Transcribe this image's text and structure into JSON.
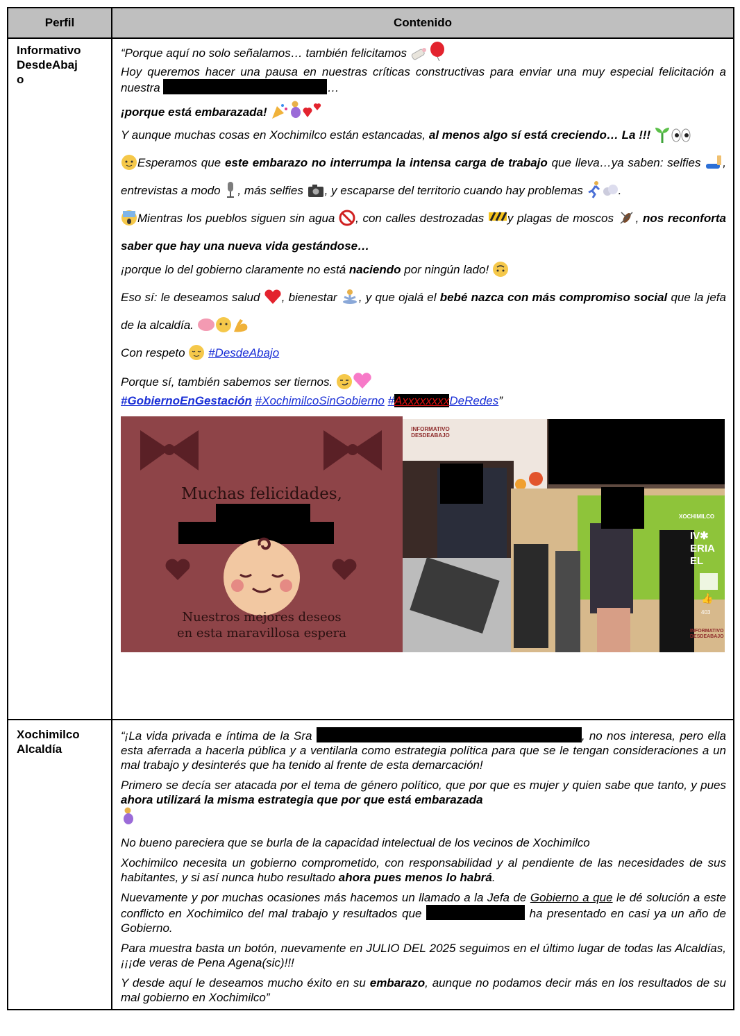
{
  "table": {
    "header_profile": "Perfil",
    "header_content": "Contenido"
  },
  "row1": {
    "profile_line1": "Informativo",
    "profile_line2": "DesdeAbaj",
    "profile_line3": "o",
    "l1": "“Porque aquí no solo señalamos… también felicitamos",
    "l2": "Hoy queremos hacer una pausa en nuestras críticas constructivas para enviar una muy especial felicitación a nuestra",
    "l2_end": "…",
    "l3_bold": "¡porque está embarazada!",
    "l4a": "Y aunque muchas cosas en Xochimilco están estancadas,",
    "l4b_bold": "al menos algo sí está creciendo… La !!!",
    "l5a": "Esperamos que",
    "l5b_bold": "este embarazo no interrumpa la intensa carga de trabajo",
    "l5c": "que lleva…ya saben: selfies",
    "l5d": ", entrevistas a modo",
    "l5e": ", más selfies",
    "l5f": ", y escaparse del territorio cuando hay problemas",
    "l5g": ".",
    "l6a": "Mientras los pueblos siguen sin agua",
    "l6b": ", con calles destrozadas",
    "l6c": "y plagas de moscos",
    "l6d": ",",
    "l6e_bold": "nos reconforta saber que hay una nueva vida gestándose…",
    "l7a": "¡porque lo del gobierno claramente no está",
    "l7b_bold": "naciendo",
    "l7c": "por ningún lado!",
    "l8a": "Eso sí: le deseamos salud",
    "l8b": ", bienestar",
    "l8c": ", y que ojalá el",
    "l8d_bold": "bebé nazca con más compromiso social",
    "l8e": "que la jefa de la alcaldía.",
    "l9a": "Con respeto",
    "l9_tag": "#DesdeAbajo",
    "l10": "Porque sí, también sabemos ser tiernos.",
    "tag1": "#GobiernoEnGestación",
    "tag2": "#XochimilcoSinGobierno",
    "tag3a": "#",
    "tag3b": "Axxxxxxxx",
    "tag3c": "DeRedes",
    "tag3_end": "”",
    "card_title": "Muchas felicidades,",
    "card_sub1": "Nuestros mejores deseos",
    "card_sub2": "en esta maravillosa espera",
    "logo_line1": "INFORMATIVO",
    "logo_line2": "DESDEABAJO",
    "xochi_label": "XOCHIMILCO",
    "feria_text": "IV✱ ERIA EL",
    "like_count": "403"
  },
  "row2": {
    "profile_line1": "Xochimilco",
    "profile_line2": "Alcaldía",
    "p1a": "“¡La vida privada e íntima de la Sra",
    "p1b": ", no nos interesa, pero ella esta aferrada a hacerla pública y a ventilarla como estrategia política para que se le tengan consideraciones a un mal trabajo y desinterés que ha tenido al frente de esta demarcación!",
    "p2a": "Primero se decía ser atacada por el tema de género político, que por que es mujer y quien sabe que tanto, y pues",
    "p2b_bold": "ahora utilizará la misma estrategia que por que está embarazada",
    "p3": "No bueno pareciera que se burla de la capacidad intelectual de los vecinos de Xochimilco",
    "p4a": "Xochimilco necesita un gobierno comprometido, con responsabilidad y al pendiente de las necesidades de sus habitantes, y si así nunca hubo resultado",
    "p4b_bold": "ahora pues menos lo habrá",
    "p4c": ".",
    "p5a": "Nuevamente y por muchas ocasiones más hacemos un llamado a la Jefa de",
    "p5_u": "Gobierno a que",
    "p5b": "le dé solución a este conflicto en Xochimilco del mal trabajo y resultados que",
    "p5c": "ha presentado en casi ya un año de Gobierno.",
    "p6": "Para muestra basta un botón, nuevamente en JULIO DEL 2025 seguimos en el último lugar de todas las Alcaldías, ¡¡¡de veras de Pena Agena(sic)!!!",
    "p7a": "Y desde aquí le deseamos mucho éxito en su",
    "p7b_bold": "embarazo",
    "p7c": ", aunque no podamos decir más en los resultados de su mal gobierno en Xochimilco”"
  },
  "icons": [
    "baby-bottle-icon",
    "balloon-icon",
    "party-popper-icon",
    "pregnant-woman-icon",
    "hearts-icon",
    "seedling-icon",
    "eyes-icon",
    "baby-face-icon",
    "selfie-arm-icon",
    "microphone-icon",
    "camera-icon",
    "running-person-icon",
    "dash-icon",
    "scared-face-icon",
    "no-water-icon",
    "construction-icon",
    "mosquito-icon",
    "upside-down-face-icon",
    "red-heart-icon",
    "meditation-icon",
    "brain-icon",
    "flexed-biceps-icon",
    "relieved-face-icon",
    "smirk-face-icon",
    "pink-heart-icon",
    "bow-icon",
    "thumbs-up-icon"
  ],
  "colors": {
    "header_bg": "#bfbfbf",
    "link": "#1a2fd6",
    "card_bg": "#8e4448",
    "redaction": "#000000"
  }
}
